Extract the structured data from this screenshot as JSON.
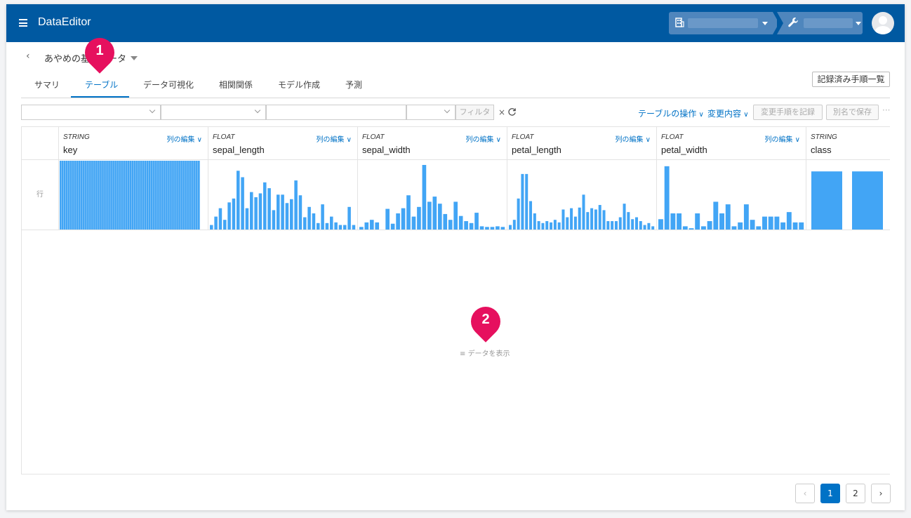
{
  "app": {
    "title": "DataEditor"
  },
  "dataset": {
    "title": "あやめの基本データ"
  },
  "tabs": [
    {
      "label": "サマリ",
      "active": false
    },
    {
      "label": "テーブル",
      "active": true
    },
    {
      "label": "データ可視化",
      "active": false
    },
    {
      "label": "相関関係",
      "active": false
    },
    {
      "label": "モデル作成",
      "active": false
    },
    {
      "label": "予測",
      "active": false
    }
  ],
  "toolbar": {
    "history_label": "記録済み手順一覧",
    "filter_label": "フィルタ",
    "clear_label": "×",
    "table_ops_label": "テーブルの操作",
    "changes_label": "変更内容",
    "record_steps_label": "変更手順を記録",
    "save_as_label": "別名で保存",
    "more_label": "···"
  },
  "table": {
    "row_label": "行",
    "edit_label": "列の編集",
    "columns": [
      {
        "type": "STRING",
        "name": "key",
        "hist": []
      },
      {
        "type": "FLOAT",
        "name": "sepal_length",
        "hist": [
          7,
          20,
          33,
          15,
          42,
          48,
          91,
          81,
          33,
          58,
          50,
          56,
          73,
          64,
          30,
          54,
          54,
          41,
          47,
          76,
          53,
          19,
          35,
          25,
          10,
          39,
          10,
          20,
          11,
          7,
          7,
          35,
          7
        ]
      },
      {
        "type": "FLOAT",
        "name": "sepal_width",
        "hist": [
          4,
          11,
          15,
          11,
          0,
          32,
          9,
          25,
          33,
          53,
          20,
          35,
          100,
          43,
          51,
          40,
          24,
          15,
          43,
          21,
          13,
          10,
          26,
          5,
          4,
          4,
          5,
          4
        ]
      },
      {
        "type": "FLOAT",
        "name": "petal_length",
        "hist": [
          7,
          15,
          48,
          86,
          86,
          44,
          25,
          13,
          10,
          13,
          11,
          15,
          11,
          31,
          19,
          33,
          20,
          34,
          54,
          27,
          33,
          31,
          38,
          30,
          13,
          13,
          13,
          19,
          40,
          27,
          16,
          19,
          13,
          7,
          10,
          5
        ]
      },
      {
        "type": "FLOAT",
        "name": "petal_width",
        "hist": [
          16,
          98,
          25,
          25,
          5,
          2,
          25,
          5,
          13,
          43,
          25,
          39,
          5,
          11,
          39,
          15,
          5,
          20,
          20,
          20,
          11,
          27,
          11,
          11
        ]
      },
      {
        "type": "STRING",
        "name": "class",
        "hist": [
          90,
          90
        ]
      }
    ]
  },
  "show_data_label": "データを表示",
  "pagination": {
    "prev": "‹",
    "pages": [
      "1",
      "2"
    ],
    "current": "1",
    "next": "›"
  },
  "callouts": [
    "1",
    "2"
  ],
  "colors": {
    "header": "#0059a1",
    "accent": "#0072c6",
    "bar": "#42a5f5",
    "callout": "#e6105e"
  }
}
